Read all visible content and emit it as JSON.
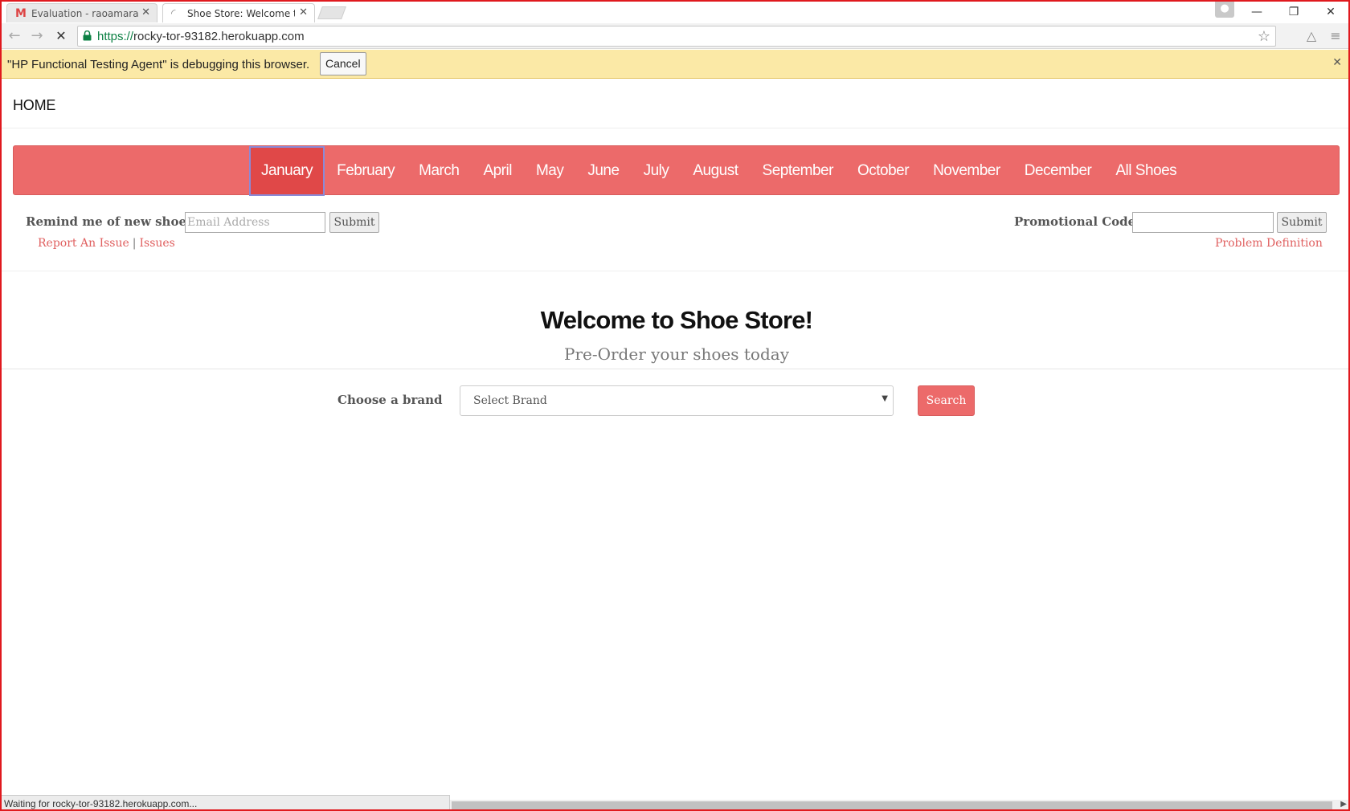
{
  "browser": {
    "tabs": [
      {
        "title": "Evaluation - raoamara@g",
        "icon": "gmail-icon"
      },
      {
        "title": "Shoe Store: Welcome to tl",
        "icon": "loading-icon"
      }
    ],
    "url_scheme": "https://",
    "url_host": "rocky-tor-93182.herokuapp.com",
    "infobar_text": "\"HP Functional Testing Agent\" is debugging this browser.",
    "infobar_cancel": "Cancel",
    "status_text": "Waiting for rocky-tor-93182.herokuapp.com..."
  },
  "page": {
    "home_label": "HOME",
    "months": [
      {
        "label": "January",
        "active": true
      },
      {
        "label": "February"
      },
      {
        "label": "March"
      },
      {
        "label": "April"
      },
      {
        "label": "May"
      },
      {
        "label": "June"
      },
      {
        "label": "July"
      },
      {
        "label": "August"
      },
      {
        "label": "September"
      },
      {
        "label": "October"
      },
      {
        "label": "November"
      },
      {
        "label": "December"
      },
      {
        "label": "All Shoes"
      }
    ],
    "remind_label": "Remind me of new shoes",
    "email_placeholder": "Email Address",
    "submit_label": "Submit",
    "report_issue": "Report An Issue",
    "link_separator": "|",
    "issues": "Issues",
    "promo_label": "Promotional Code",
    "problem_definition": "Problem Definition",
    "welcome_title": "Welcome to Shoe Store!",
    "subtitle": "Pre-Order your shoes today",
    "brand_label": "Choose a brand",
    "brand_selected": "Select Brand",
    "search_label": "Search"
  },
  "colors": {
    "accent": "#ec6a6a",
    "accent_active": "#e04848",
    "infobar": "#fbe9a6",
    "link": "#e06060"
  }
}
